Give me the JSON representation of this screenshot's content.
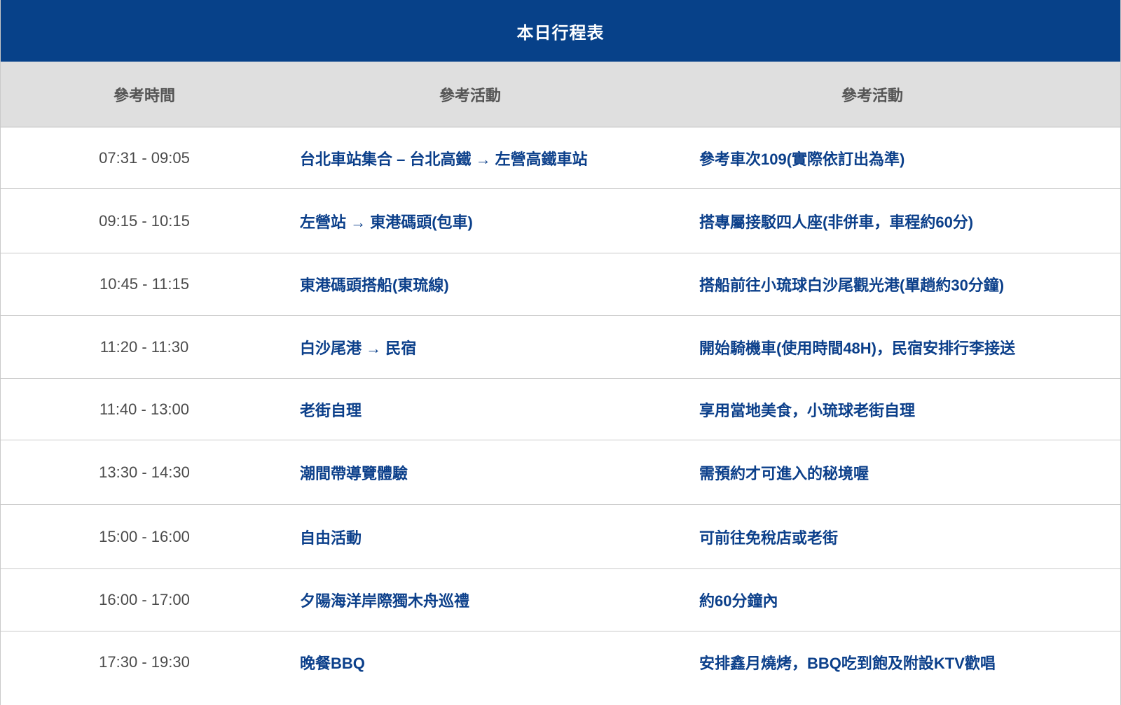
{
  "title": "本日行程表",
  "headers": {
    "time": "參考時間",
    "activity": "參考活動",
    "note": "參考活動"
  },
  "rows": [
    {
      "time": "07:31 - 09:05",
      "activity": "台北車站集合 – 台北高鐵 → 左營高鐵車站",
      "note": "參考車次109(實際依訂出為準)"
    },
    {
      "time": "09:15 - 10:15",
      "activity": "左營站 → 東港碼頭(包車)",
      "note": "搭專屬接駁四人座(非併車，車程約60分)"
    },
    {
      "time": "10:45 - 11:15",
      "activity": "東港碼頭搭船(東琉線)",
      "note": "搭船前往小琉球白沙尾觀光港(單趟約30分鐘)"
    },
    {
      "time": "11:20 - 11:30",
      "activity": "白沙尾港 → 民宿",
      "note": "開始騎機車(使用時間48H)，民宿安排行李接送"
    },
    {
      "time": "11:40 - 13:00",
      "activity": "老街自理",
      "note": "享用當地美食，小琉球老街自理"
    },
    {
      "time": "13:30 - 14:30",
      "activity": "潮間帶導覽體驗",
      "note": "需預約才可進入的秘境喔"
    },
    {
      "time": "15:00 - 16:00",
      "activity": "自由活動",
      "note": "可前往免稅店或老街"
    },
    {
      "time": "16:00 - 17:00",
      "activity": "夕陽海洋岸際獨木舟巡禮",
      "note": "約60分鐘內"
    },
    {
      "time": "17:30 - 19:30",
      "activity": "晚餐BBQ",
      "note": "安排鑫月燒烤，BBQ吃到飽及附設KTV歡唱"
    }
  ],
  "colors": {
    "title_bg": "#074189",
    "header_bg": "#dfdfdf",
    "activity_text": "#0b3f8a",
    "time_text": "#4a4a4a"
  }
}
